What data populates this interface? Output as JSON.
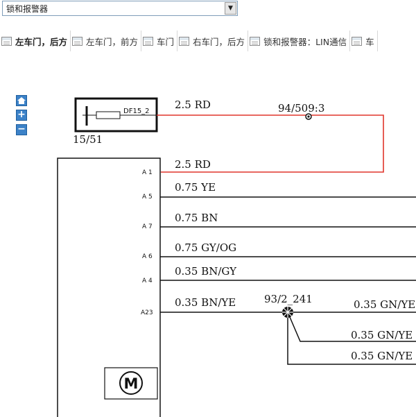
{
  "dropdown": {
    "selected": "锁和报警器",
    "arrow": "▼"
  },
  "tabs": [
    {
      "label": "左车门，后方",
      "active": true
    },
    {
      "label": "左车门，前方",
      "active": false
    },
    {
      "label": "车门",
      "active": false
    },
    {
      "label": "右车门，后方",
      "active": false
    },
    {
      "label": "锁和报警器：LIN通信",
      "active": false
    },
    {
      "label": "车",
      "active": false
    }
  ],
  "zoom": {
    "home_icon": "home-icon",
    "zoom_in": "+",
    "zoom_out": "−"
  },
  "diagram": {
    "fuse_label": "DF15_2",
    "fuse_ref": "15/51",
    "splice_top": "94/509:3",
    "splice_mid": "93/2_241",
    "motor_symbol": "M",
    "wires": {
      "fuse_out": "2.5 RD",
      "a1": "2.5 RD",
      "a5": "0.75 YE",
      "a7": "0.75 BN",
      "a6": "0.75 GY/OG",
      "a4": "0.35 BN/GY",
      "a23": "0.35 BN/YE",
      "branch1": "0.35 GN/YE",
      "branch2": "0.35 GN/YE",
      "branch3": "0.35 GN/YE"
    },
    "pins": {
      "a1": "A 1",
      "a5": "A 5",
      "a7": "A 7",
      "a6": "A 6",
      "a4": "A 4",
      "a23": "A23"
    },
    "colors": {
      "red_wire": "#e0352b",
      "black_wire": "#111111"
    }
  }
}
